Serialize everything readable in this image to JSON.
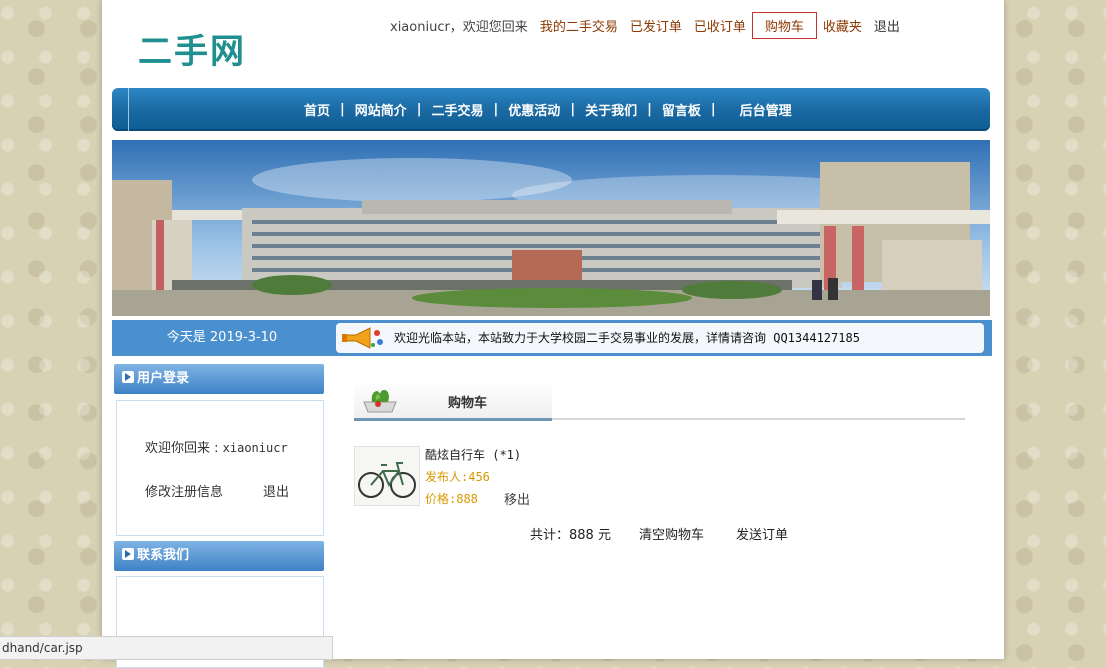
{
  "header": {
    "logo_text": "二手网",
    "username_greeting": "xiaoniucr，欢迎您回来",
    "links": {
      "my_trades": "我的二手交易",
      "sent_orders": "已发订单",
      "received_orders": "已收订单",
      "cart": "购物车",
      "favorites": "收藏夹",
      "logout": "退出"
    }
  },
  "nav": {
    "items": [
      "首页",
      "网站简介",
      "二手交易",
      "优惠活动",
      "关于我们",
      "留言板",
      "后台管理"
    ],
    "separator": "|"
  },
  "info_bar": {
    "date": "今天是 2019-3-10",
    "marquee": "欢迎光临本站，本站致力于大学校园二手交易事业的发展，详情请咨询 QQ1344127185"
  },
  "sidebar": {
    "login_title": "用户登录",
    "welcome_label": "欢迎你回来 :",
    "welcome_user": "xiaoniucr",
    "edit_info": "修改注册信息",
    "logout": "退出",
    "contact_title": "联系我们"
  },
  "cart": {
    "title": "购物车",
    "items": [
      {
        "name": "酷炫自行车 (*1)",
        "seller": "发布人:456",
        "price": "价格:888",
        "remove": "移出"
      }
    ],
    "total": "共计：888 元",
    "clear": "清空购物车",
    "send_order": "发送订单"
  },
  "status_bar": {
    "url": "dhand/car.jsp"
  },
  "colors": {
    "accent": "#1b6aa3",
    "link": "#8b3a00",
    "price": "#d99a00",
    "info_bar": "#4a90cf"
  }
}
